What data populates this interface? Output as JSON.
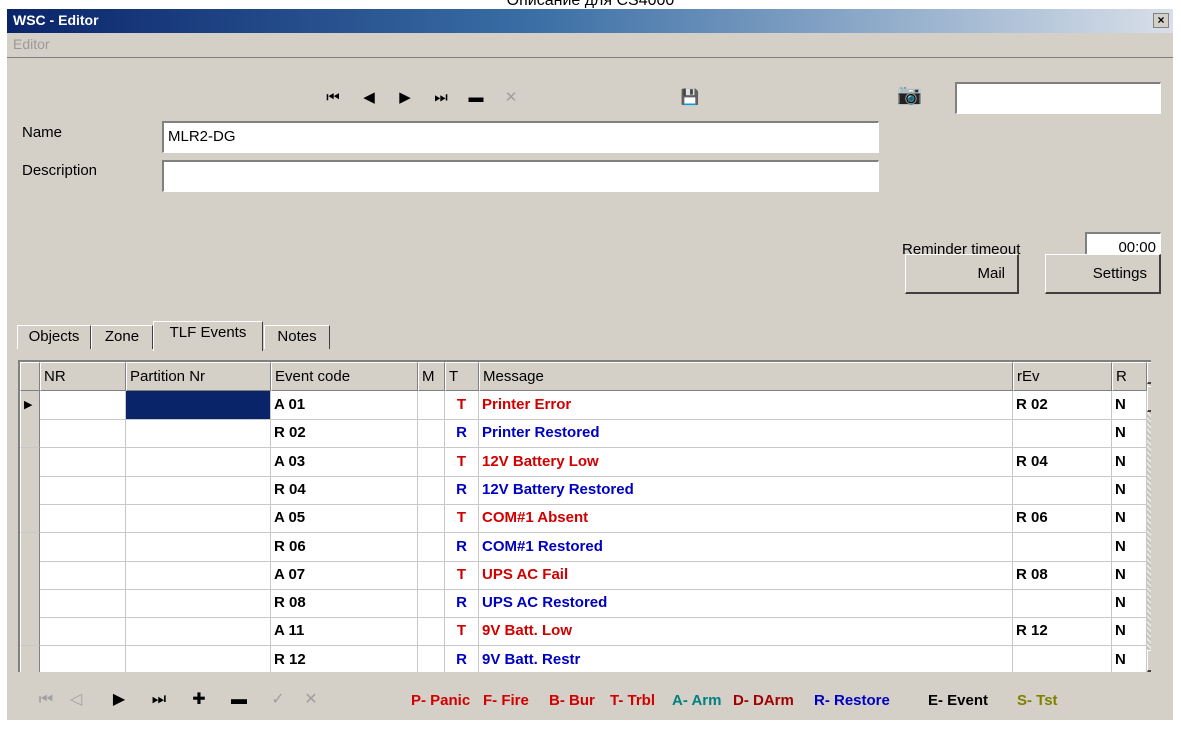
{
  "caption": "Описание для CS4000",
  "window": {
    "title": "WSC - Editor",
    "close_label": "×"
  },
  "menu": {
    "editor": "Editor"
  },
  "nav_top": [
    {
      "name": "first-record-button",
      "glyph": "⏮",
      "disabled": false
    },
    {
      "name": "prev-record-button",
      "glyph": "◀",
      "disabled": false
    },
    {
      "name": "next-record-button",
      "glyph": "▶",
      "disabled": false
    },
    {
      "name": "last-record-button",
      "glyph": "⏭",
      "disabled": false
    },
    {
      "name": "delete-record-button",
      "glyph": "▬",
      "disabled": false
    },
    {
      "name": "cancel-edit-button",
      "glyph": "✕",
      "disabled": true
    },
    {
      "name": "save-record-button",
      "glyph": "💾",
      "disabled": true
    }
  ],
  "form": {
    "name_label": "Name",
    "name_value": "MLR2-DG",
    "description_label": "Description",
    "description_value": "",
    "camera_value": "",
    "reminder_label": "Reminder timeout",
    "reminder_value": "00:00",
    "mail_button": "Mail",
    "settings_button": "Settings"
  },
  "tabs": [
    "Objects",
    "Zone",
    "TLF Events",
    "Notes"
  ],
  "active_tab": "TLF Events",
  "grid": {
    "columns": [
      "NR",
      "Partition Nr",
      "Event code",
      "M",
      "T",
      "Message",
      "rEv",
      "R"
    ],
    "rows": [
      {
        "nr": "",
        "partition": "",
        "code": "A 01",
        "m": "",
        "t": "T",
        "message": "Printer Error",
        "rev": "R 02",
        "r": "N"
      },
      {
        "nr": "",
        "partition": "",
        "code": "R 02",
        "m": "",
        "t": "R",
        "message": "Printer Restored",
        "rev": "",
        "r": "N"
      },
      {
        "nr": "",
        "partition": "",
        "code": "A 03",
        "m": "",
        "t": "T",
        "message": "12V Battery Low",
        "rev": "R 04",
        "r": "N"
      },
      {
        "nr": "",
        "partition": "",
        "code": "R 04",
        "m": "",
        "t": "R",
        "message": "12V Battery Restored",
        "rev": "",
        "r": "N"
      },
      {
        "nr": "",
        "partition": "",
        "code": "A 05",
        "m": "",
        "t": "T",
        "message": "COM#1 Absent",
        "rev": "R 06",
        "r": "N"
      },
      {
        "nr": "",
        "partition": "",
        "code": "R 06",
        "m": "",
        "t": "R",
        "message": "COM#1 Restored",
        "rev": "",
        "r": "N"
      },
      {
        "nr": "",
        "partition": "",
        "code": "A 07",
        "m": "",
        "t": "T",
        "message": "UPS AC Fail",
        "rev": "R 08",
        "r": "N"
      },
      {
        "nr": "",
        "partition": "",
        "code": "R 08",
        "m": "",
        "t": "R",
        "message": "UPS AC Restored",
        "rev": "",
        "r": "N"
      },
      {
        "nr": "",
        "partition": "",
        "code": "A 11",
        "m": "",
        "t": "T",
        "message": "9V Batt. Low",
        "rev": "R 12",
        "r": "N"
      },
      {
        "nr": "",
        "partition": "",
        "code": "R 12",
        "m": "",
        "t": "R",
        "message": "9V Batt. Restr",
        "rev": "",
        "r": "N"
      }
    ]
  },
  "colors": {
    "trouble": "#d00000",
    "restore": "#0000c0"
  },
  "nav_bottom": [
    {
      "name": "first-row-button",
      "glyph": "⏮",
      "disabled": true
    },
    {
      "name": "prev-row-button",
      "glyph": "◁",
      "disabled": true
    },
    {
      "name": "next-row-button",
      "glyph": "▶",
      "disabled": false
    },
    {
      "name": "last-row-button",
      "glyph": "⏭",
      "disabled": false
    },
    {
      "name": "insert-row-button",
      "glyph": "✚",
      "disabled": false
    },
    {
      "name": "delete-row-button",
      "glyph": "▬",
      "disabled": false
    },
    {
      "name": "post-row-button",
      "glyph": "✓",
      "disabled": true
    },
    {
      "name": "cancel-row-button",
      "glyph": "✕",
      "disabled": true
    }
  ],
  "legend": [
    {
      "text": "P- Panic",
      "color": "#d00000"
    },
    {
      "text": "F- Fire",
      "color": "#d00000"
    },
    {
      "text": "B- Bur",
      "color": "#d00000"
    },
    {
      "text": "T- Trbl",
      "color": "#d00000"
    },
    {
      "text": "A- Arm",
      "color": "#008080"
    },
    {
      "text": "D- DArm",
      "color": "#a00000"
    },
    {
      "text": "R- Restore",
      "color": "#0000c0"
    },
    {
      "text": "E- Event",
      "color": "#000000"
    },
    {
      "text": "S- Tst",
      "color": "#808000"
    }
  ]
}
